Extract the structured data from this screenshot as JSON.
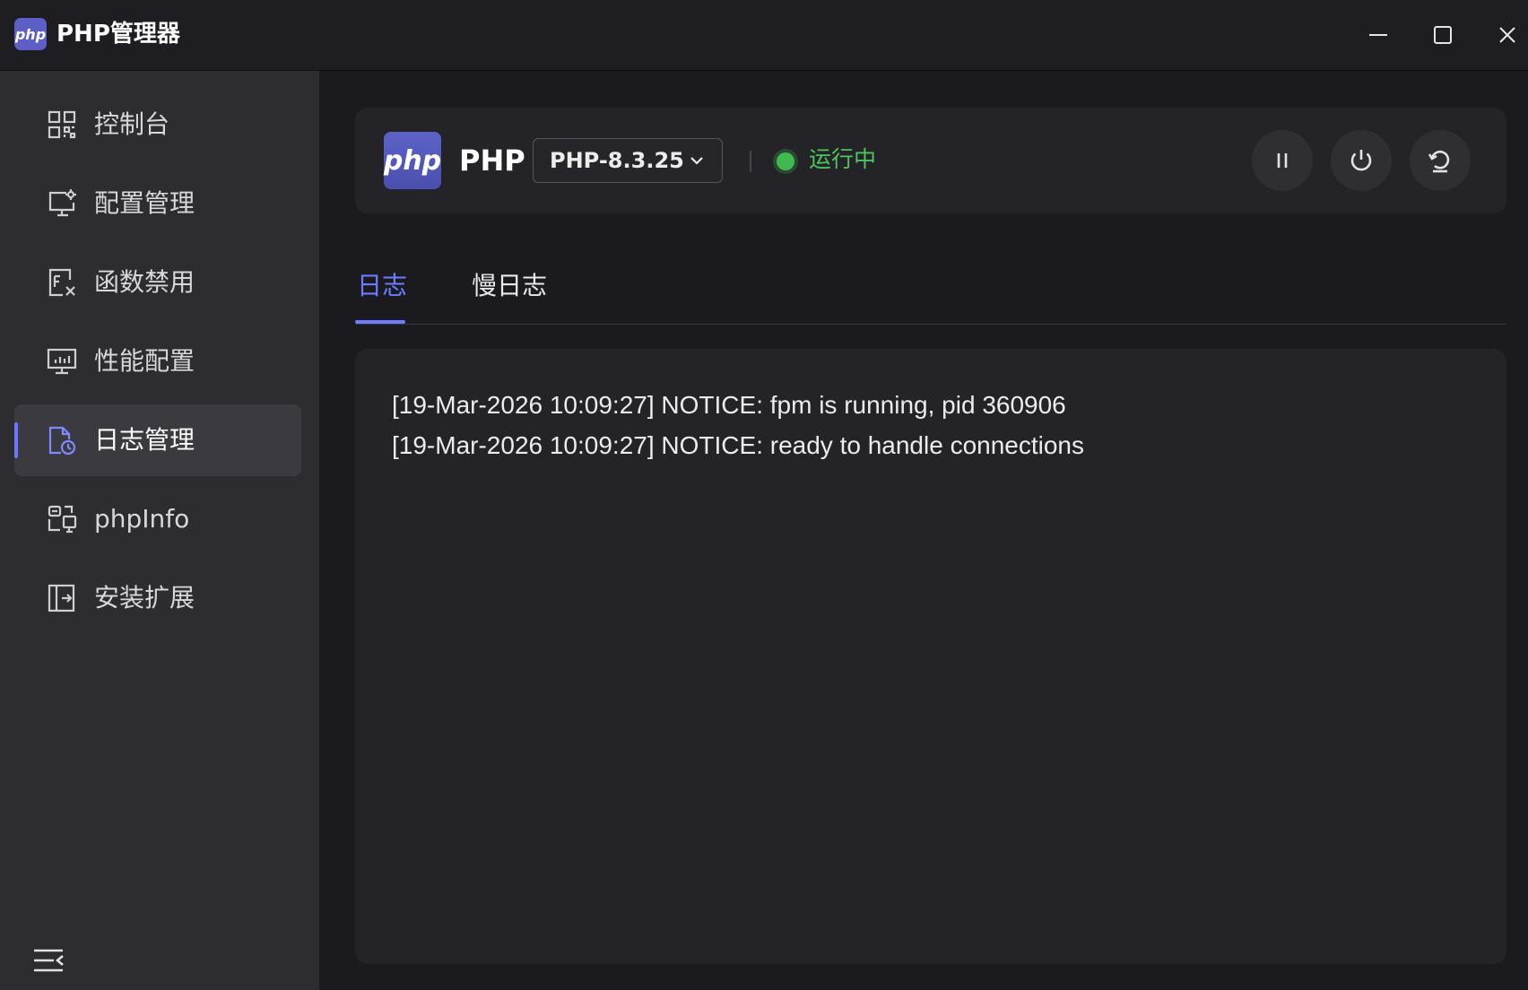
{
  "app": {
    "logo_text": "php",
    "title": "PHP管理器"
  },
  "window_controls": [
    {
      "name": "minimize-icon"
    },
    {
      "name": "maximize-icon"
    },
    {
      "name": "close-icon"
    }
  ],
  "sidebar": {
    "items": [
      {
        "label": "控制台",
        "icon": "dashboard-grid-icon",
        "active": false
      },
      {
        "label": "配置管理",
        "icon": "monitor-settings-icon",
        "active": false
      },
      {
        "label": "函数禁用",
        "icon": "function-disable-icon",
        "active": false
      },
      {
        "label": "性能配置",
        "icon": "performance-monitor-icon",
        "active": false
      },
      {
        "label": "日志管理",
        "icon": "log-file-icon",
        "active": true
      },
      {
        "label": "phpInfo",
        "icon": "phpinfo-icon",
        "active": false
      },
      {
        "label": "安装扩展",
        "icon": "install-extension-icon",
        "active": false
      }
    ],
    "collapse_icon": "menu-collapse-icon"
  },
  "php_card": {
    "logo_text": "php",
    "name": "PHP",
    "version_selected": "PHP-8.3.25",
    "status": "运行中",
    "status_color": "#3fb950",
    "actions": [
      "pause-icon",
      "power-icon",
      "restart-icon"
    ]
  },
  "tabs": [
    {
      "label": "日志",
      "active": true
    },
    {
      "label": "慢日志",
      "active": false
    }
  ],
  "log": {
    "lines": [
      "[19-Mar-2026 10:09:27] NOTICE: fpm is running, pid 360906",
      "[19-Mar-2026 10:09:27] NOTICE: ready to handle connections"
    ]
  },
  "colors": {
    "accent": "#6b7cff",
    "running": "#3fb950"
  }
}
